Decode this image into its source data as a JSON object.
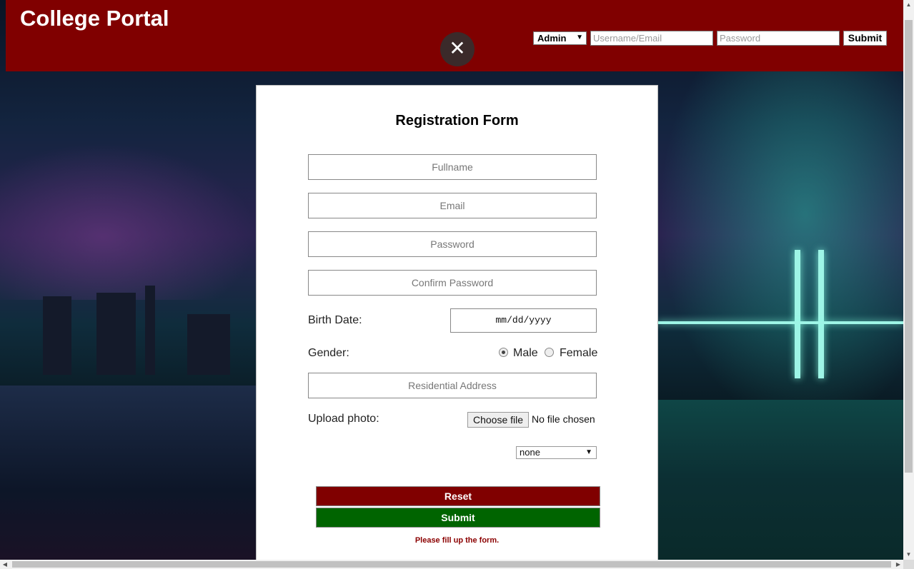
{
  "header": {
    "title": "College Portal",
    "role_select_value": "Admin",
    "username_placeholder": "Username/Email",
    "password_placeholder": "Password",
    "submit_label": "Submit",
    "brand_color": "#800000"
  },
  "overlay": {
    "close_icon": "close-icon"
  },
  "form": {
    "title": "Registration Form",
    "fullname_placeholder": "Fullname",
    "email_placeholder": "Email",
    "password_placeholder": "Password",
    "confirm_password_placeholder": "Confirm Password",
    "birth_date_label": "Birth Date:",
    "birth_date_value": "mm/dd/yyyy",
    "gender_label": "Gender:",
    "gender_options": [
      "Male",
      "Female"
    ],
    "gender_selected": "Male",
    "address_placeholder": "Residential Address",
    "upload_label": "Upload photo:",
    "choose_file_label": "Choose file",
    "no_file_text": "No file chosen",
    "extra_select_value": "none",
    "reset_label": "Reset",
    "submit_label": "Submit",
    "note": "Please fill up the form.",
    "reset_color": "#800000",
    "submit_color": "#006400"
  }
}
